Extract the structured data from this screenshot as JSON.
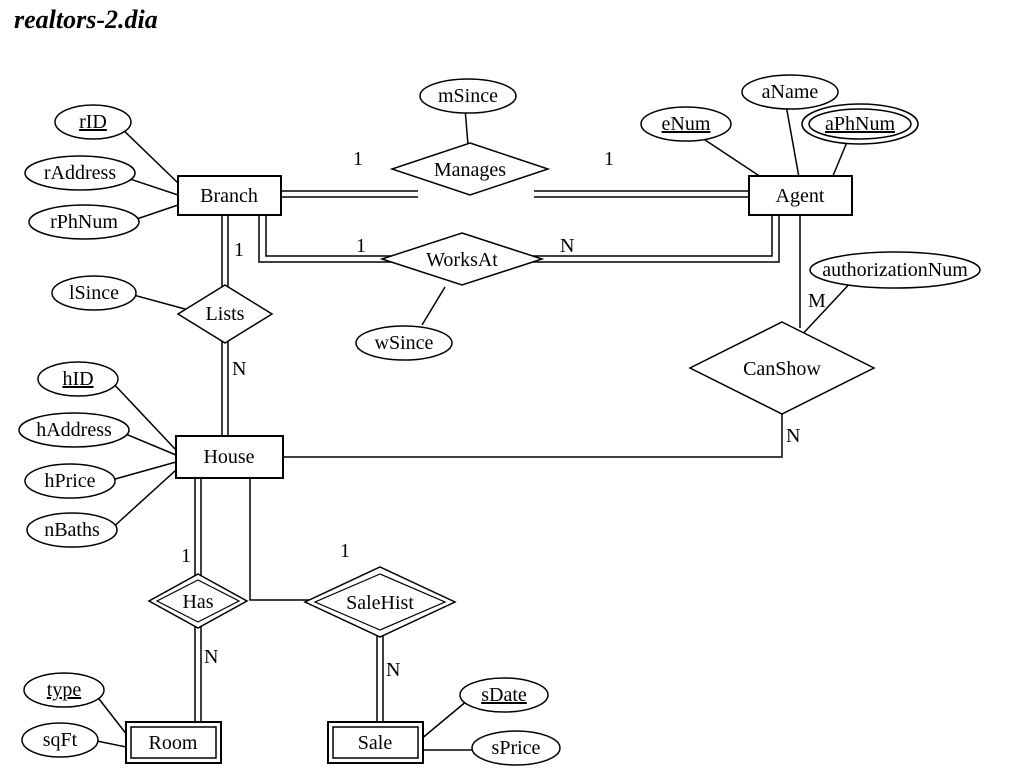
{
  "title": "realtors-2.dia",
  "nodes": {
    "branch": {
      "label": "Branch"
    },
    "agent": {
      "label": "Agent"
    },
    "house": {
      "label": "House"
    },
    "room": {
      "label": "Room"
    },
    "sale": {
      "label": "Sale"
    },
    "manages": {
      "label": "Manages"
    },
    "worksat": {
      "label": "WorksAt"
    },
    "lists": {
      "label": "Lists"
    },
    "canshow": {
      "label": "CanShow"
    },
    "has": {
      "label": "Has"
    },
    "salehist": {
      "label": "SaleHist"
    }
  },
  "attrs": {
    "rID": {
      "label": "rID"
    },
    "rAddress": {
      "label": "rAddress"
    },
    "rPhNum": {
      "label": "rPhNum"
    },
    "lSince": {
      "label": "lSince"
    },
    "mSince": {
      "label": "mSince"
    },
    "wSince": {
      "label": "wSince"
    },
    "eNum": {
      "label": "eNum"
    },
    "aName": {
      "label": "aName"
    },
    "aPhNum": {
      "label": "aPhNum"
    },
    "authNum": {
      "label": "authorizationNum"
    },
    "hID": {
      "label": "hID"
    },
    "hAddress": {
      "label": "hAddress"
    },
    "hPrice": {
      "label": "hPrice"
    },
    "nBaths": {
      "label": "nBaths"
    },
    "type": {
      "label": "type"
    },
    "sqFt": {
      "label": "sqFt"
    },
    "sDate": {
      "label": "sDate"
    },
    "sPrice": {
      "label": "sPrice"
    }
  },
  "card": {
    "managesBranch": "1",
    "managesAgent": "1",
    "worksatBranch": "1",
    "worksatAgent": "N",
    "listsBranch": "1",
    "listsHouse": "N",
    "canshowAgent": "M",
    "canshowHouse": "N",
    "hasHouse": "1",
    "hasRoom": "N",
    "salehistHouse": "1",
    "salehistSale": "N"
  },
  "chart_data": {
    "type": "er-diagram",
    "entities": [
      {
        "name": "Branch",
        "attributes": [
          {
            "name": "rID",
            "key": true
          },
          {
            "name": "rAddress"
          },
          {
            "name": "rPhNum"
          }
        ]
      },
      {
        "name": "Agent",
        "attributes": [
          {
            "name": "eNum",
            "key": true
          },
          {
            "name": "aName"
          },
          {
            "name": "aPhNum",
            "multivalued": true
          }
        ]
      },
      {
        "name": "House",
        "attributes": [
          {
            "name": "hID",
            "key": true
          },
          {
            "name": "hAddress"
          },
          {
            "name": "hPrice"
          },
          {
            "name": "nBaths"
          }
        ]
      },
      {
        "name": "Room",
        "weak": true,
        "ownerOf": "House",
        "attributes": [
          {
            "name": "type",
            "partialKey": true
          },
          {
            "name": "sqFt"
          }
        ]
      },
      {
        "name": "Sale",
        "weak": true,
        "ownerOf": "House",
        "attributes": [
          {
            "name": "sDate",
            "partialKey": true
          },
          {
            "name": "sPrice"
          }
        ]
      }
    ],
    "relationships": [
      {
        "name": "Manages",
        "between": [
          "Branch",
          "Agent"
        ],
        "cardinality": {
          "Branch": "1",
          "Agent": "1"
        },
        "totalParticipation": [
          "Branch",
          "Agent"
        ],
        "attributes": [
          "mSince"
        ]
      },
      {
        "name": "WorksAt",
        "between": [
          "Branch",
          "Agent"
        ],
        "cardinality": {
          "Branch": "1",
          "Agent": "N"
        },
        "totalParticipation": [
          "Branch",
          "Agent"
        ],
        "attributes": [
          "wSince"
        ]
      },
      {
        "name": "Lists",
        "between": [
          "Branch",
          "House"
        ],
        "cardinality": {
          "Branch": "1",
          "House": "N"
        },
        "totalParticipation": [
          "Branch",
          "House"
        ],
        "attributes": [
          "lSince"
        ]
      },
      {
        "name": "CanShow",
        "between": [
          "Agent",
          "House"
        ],
        "cardinality": {
          "Agent": "M",
          "House": "N"
        },
        "attributes": [
          "authorizationNum"
        ]
      },
      {
        "name": "Has",
        "identifying": true,
        "between": [
          "House",
          "Room"
        ],
        "cardinality": {
          "House": "1",
          "Room": "N"
        },
        "totalParticipation": [
          "House",
          "Room"
        ]
      },
      {
        "name": "SaleHist",
        "identifying": true,
        "between": [
          "House",
          "Sale"
        ],
        "cardinality": {
          "House": "1",
          "Sale": "N"
        },
        "totalParticipation": [
          "Sale"
        ]
      }
    ]
  }
}
